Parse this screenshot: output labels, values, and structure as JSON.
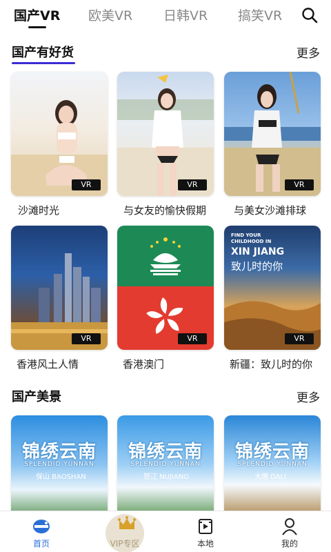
{
  "top_tabs": [
    {
      "label": "国产VR",
      "active": true
    },
    {
      "label": "欧美VR",
      "active": false
    },
    {
      "label": "日韩VR",
      "active": false
    },
    {
      "label": "搞笑VR",
      "active": false
    }
  ],
  "search_icon": "search-icon",
  "sections": [
    {
      "title": "国产有好货",
      "more": "更多",
      "items": [
        {
          "caption": "沙滩时光",
          "badge": "VR"
        },
        {
          "caption": "与女友的愉快假期",
          "badge": "VR"
        },
        {
          "caption": "与美女沙滩排球",
          "badge": "VR"
        },
        {
          "caption": "香港风土人情",
          "badge": "VR"
        },
        {
          "caption": "香港澳门",
          "badge": "VR"
        },
        {
          "caption": "新疆：致儿时的你",
          "badge": "VR"
        }
      ]
    },
    {
      "title": "国产美景",
      "more": "更多",
      "items": [
        {
          "card_title": "锦绣云南",
          "card_sub": "SPLENDID YUNNAN",
          "place": "保山 BAOSHAN"
        },
        {
          "card_title": "锦绣云南",
          "card_sub": "SPLENDID YUNNAN",
          "place": "怒江 NUJIANG"
        },
        {
          "card_title": "锦绣云南",
          "card_sub": "SPLENDID YUNNAN",
          "place": "大理 DALI"
        }
      ]
    }
  ],
  "xinjiang_card": {
    "line1": "FIND YOUR",
    "line2": "CHILDHOOD IN",
    "line3": "XIN JIANG",
    "line4": "致儿时的你"
  },
  "bottom_nav": [
    {
      "label": "首页",
      "icon": "home-icon",
      "active": true
    },
    {
      "label": "VIP专区",
      "icon": "crown-icon",
      "active": false
    },
    {
      "label": "本地",
      "icon": "local-video-icon",
      "active": false
    },
    {
      "label": "我的",
      "icon": "profile-icon",
      "active": false
    }
  ],
  "colors": {
    "accent": "#3a2bd6",
    "active_nav": "#2a6fd6",
    "vip_gold": "#d7a12a"
  }
}
